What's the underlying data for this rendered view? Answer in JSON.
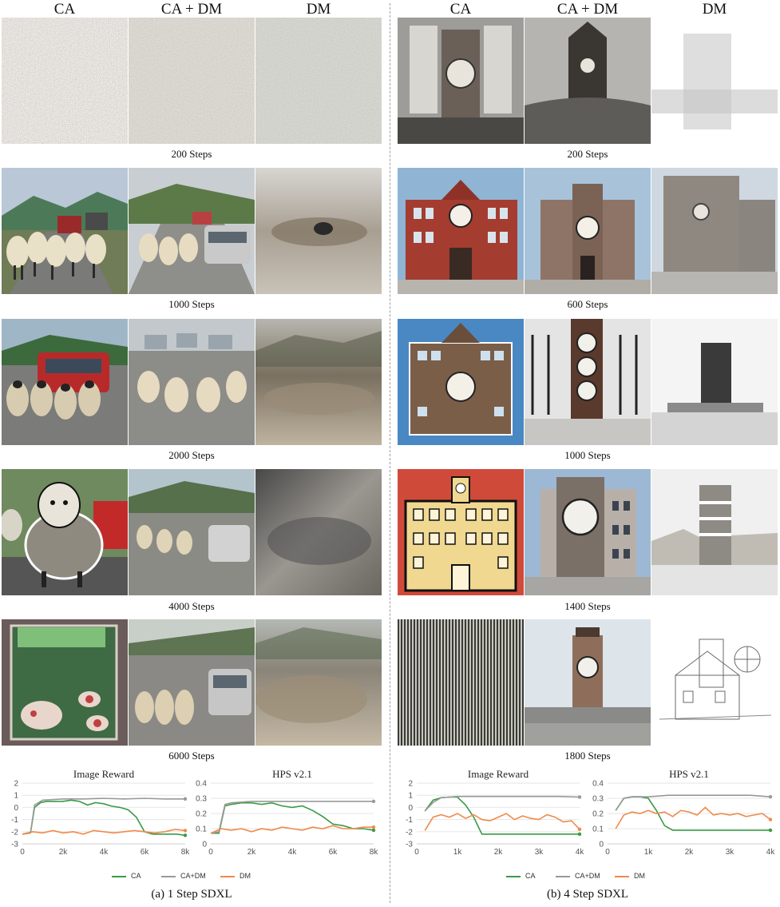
{
  "left_panel": {
    "headers": [
      "CA",
      "CA + DM",
      "DM"
    ],
    "step_labels": [
      "200 Steps",
      "1000 Steps",
      "2000 Steps",
      "4000 Steps",
      "6000 Steps"
    ],
    "caption": "(a) 1 Step SDXL"
  },
  "right_panel": {
    "headers": [
      "CA",
      "CA + DM",
      "DM"
    ],
    "step_labels": [
      "200 Steps",
      "600 Steps",
      "1000 Steps",
      "1400 Steps",
      "1800 Steps"
    ],
    "caption": "(b) 4 Step SDXL"
  },
  "legend": [
    "CA",
    "CA+DM",
    "DM"
  ],
  "colors": {
    "CA": "#3a9a46",
    "CA+DM": "#999999",
    "DM": "#f08a4b"
  },
  "chart_data": [
    {
      "type": "line",
      "title": "Image Reward",
      "panel": "left",
      "xlim": [
        0,
        8000
      ],
      "ylim": [
        -3,
        2
      ],
      "xticks": [
        "0",
        "2k",
        "4k",
        "6k",
        "8k"
      ],
      "yticks": [
        "-3",
        "-2",
        "-1",
        "0",
        "1",
        "2"
      ],
      "series": [
        {
          "name": "CA",
          "x": [
            0,
            400,
            600,
            900,
            1200,
            1600,
            2000,
            2400,
            2800,
            3200,
            3600,
            4000,
            4400,
            4800,
            5200,
            5600,
            6000,
            6400,
            7000,
            7600,
            8000
          ],
          "y": [
            -2.2,
            -2.1,
            0.0,
            0.4,
            0.5,
            0.5,
            0.5,
            0.6,
            0.5,
            0.2,
            0.4,
            0.3,
            0.1,
            0.0,
            -0.2,
            -0.8,
            -2.0,
            -2.2,
            -2.2,
            -2.2,
            -2.3
          ]
        },
        {
          "name": "CA+DM",
          "x": [
            0,
            400,
            600,
            1000,
            2000,
            3000,
            4000,
            5000,
            6000,
            7000,
            8000
          ],
          "y": [
            -2.2,
            -2.1,
            0.2,
            0.6,
            0.7,
            0.7,
            0.75,
            0.7,
            0.75,
            0.7,
            0.7
          ]
        },
        {
          "name": "DM",
          "x": [
            0,
            500,
            1000,
            1500,
            2000,
            2500,
            3000,
            3500,
            4000,
            4500,
            5000,
            5500,
            6000,
            6500,
            7000,
            7500,
            8000
          ],
          "y": [
            -2.2,
            -2.0,
            -2.1,
            -1.9,
            -2.1,
            -2.0,
            -2.2,
            -1.9,
            -2.0,
            -2.1,
            -2.0,
            -1.9,
            -2.0,
            -2.1,
            -2.0,
            -1.8,
            -1.9
          ]
        }
      ]
    },
    {
      "type": "line",
      "title": "HPS v2.1",
      "panel": "left",
      "xlim": [
        0,
        8000
      ],
      "ylim": [
        0,
        0.4
      ],
      "xticks": [
        "0",
        "2k",
        "4k",
        "6k",
        "8k"
      ],
      "yticks": [
        "0",
        "0.1",
        "0.2",
        "0.3",
        "0.4"
      ],
      "series": [
        {
          "name": "CA",
          "x": [
            0,
            400,
            700,
            1000,
            1500,
            2000,
            2500,
            3000,
            3500,
            4000,
            4500,
            5000,
            5500,
            6000,
            6500,
            7000,
            7500,
            8000
          ],
          "y": [
            0.07,
            0.07,
            0.25,
            0.26,
            0.27,
            0.27,
            0.26,
            0.27,
            0.25,
            0.24,
            0.25,
            0.22,
            0.18,
            0.13,
            0.12,
            0.1,
            0.1,
            0.09
          ]
        },
        {
          "name": "CA+DM",
          "x": [
            0,
            400,
            700,
            1000,
            2000,
            3000,
            4000,
            5000,
            6000,
            7000,
            8000
          ],
          "y": [
            0.07,
            0.08,
            0.26,
            0.27,
            0.28,
            0.28,
            0.28,
            0.28,
            0.28,
            0.28,
            0.28
          ]
        },
        {
          "name": "DM",
          "x": [
            0,
            500,
            1000,
            1500,
            2000,
            2500,
            3000,
            3500,
            4000,
            4500,
            5000,
            5500,
            6000,
            6500,
            7000,
            7500,
            8000
          ],
          "y": [
            0.07,
            0.1,
            0.09,
            0.1,
            0.08,
            0.1,
            0.09,
            0.11,
            0.1,
            0.09,
            0.11,
            0.1,
            0.12,
            0.1,
            0.1,
            0.11,
            0.11
          ]
        }
      ]
    },
    {
      "type": "line",
      "title": "Image Reward",
      "panel": "right",
      "xlim": [
        0,
        4000
      ],
      "ylim": [
        -3,
        2
      ],
      "xticks": [
        "0",
        "1k",
        "2k",
        "3k",
        "4k"
      ],
      "yticks": [
        "-3",
        "-2",
        "-1",
        "0",
        "1",
        "2"
      ],
      "series": [
        {
          "name": "CA",
          "x": [
            200,
            400,
            600,
            800,
            1000,
            1200,
            1400,
            1600,
            2000,
            2500,
            3000,
            3500,
            4000
          ],
          "y": [
            -0.3,
            0.6,
            0.8,
            0.85,
            0.85,
            0.2,
            -0.8,
            -2.2,
            -2.2,
            -2.2,
            -2.2,
            -2.2,
            -2.2
          ]
        },
        {
          "name": "CA+DM",
          "x": [
            200,
            400,
            600,
            800,
            1000,
            1500,
            2000,
            2500,
            3000,
            3500,
            4000
          ],
          "y": [
            -0.3,
            0.4,
            0.8,
            0.85,
            0.9,
            0.9,
            0.9,
            0.9,
            0.9,
            0.9,
            0.85
          ]
        },
        {
          "name": "DM",
          "x": [
            200,
            400,
            600,
            800,
            1000,
            1200,
            1400,
            1600,
            1800,
            2000,
            2200,
            2400,
            2600,
            2800,
            3000,
            3200,
            3400,
            3600,
            3800,
            4000
          ],
          "y": [
            -1.9,
            -0.8,
            -0.6,
            -0.8,
            -0.5,
            -0.9,
            -0.6,
            -1.0,
            -1.1,
            -0.8,
            -0.5,
            -1.0,
            -0.7,
            -0.9,
            -1.0,
            -0.6,
            -0.8,
            -1.2,
            -1.1,
            -1.8
          ]
        }
      ]
    },
    {
      "type": "line",
      "title": "HPS v2.1",
      "panel": "right",
      "xlim": [
        0,
        4000
      ],
      "ylim": [
        0,
        0.4
      ],
      "xticks": [
        "0",
        "1k",
        "2k",
        "3k",
        "4k"
      ],
      "yticks": [
        "0",
        "0.1",
        "0.2",
        "0.3",
        "0.4"
      ],
      "series": [
        {
          "name": "CA",
          "x": [
            200,
            400,
            600,
            800,
            1000,
            1200,
            1400,
            1600,
            2000,
            2500,
            3000,
            3500,
            4000
          ],
          "y": [
            0.22,
            0.3,
            0.31,
            0.31,
            0.3,
            0.22,
            0.12,
            0.09,
            0.09,
            0.09,
            0.09,
            0.09,
            0.09
          ]
        },
        {
          "name": "CA+DM",
          "x": [
            200,
            400,
            600,
            800,
            1000,
            1500,
            2000,
            2500,
            3000,
            3500,
            4000
          ],
          "y": [
            0.22,
            0.3,
            0.31,
            0.31,
            0.31,
            0.32,
            0.32,
            0.32,
            0.32,
            0.32,
            0.31
          ]
        },
        {
          "name": "DM",
          "x": [
            200,
            400,
            600,
            800,
            1000,
            1200,
            1400,
            1600,
            1800,
            2000,
            2200,
            2400,
            2600,
            2800,
            3000,
            3200,
            3400,
            3600,
            3800,
            4000
          ],
          "y": [
            0.1,
            0.19,
            0.21,
            0.2,
            0.22,
            0.2,
            0.21,
            0.18,
            0.22,
            0.21,
            0.19,
            0.24,
            0.19,
            0.2,
            0.19,
            0.2,
            0.18,
            0.19,
            0.2,
            0.16
          ]
        }
      ]
    }
  ]
}
